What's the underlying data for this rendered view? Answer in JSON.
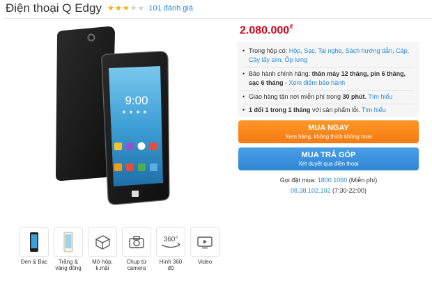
{
  "product": {
    "title": "Điện thoại Q Edgy",
    "rating_stars": 3,
    "rating_max": 5,
    "reviews_label": "101 đánh giá"
  },
  "phone_screen": {
    "time": "9:00"
  },
  "gallery": {
    "items": [
      {
        "label": "Đen & Bạc",
        "icon": "black-silver-phone-thumbnail"
      },
      {
        "label": "Trắng &\nvàng đồng",
        "icon": "white-gold-phone-thumbnail"
      },
      {
        "label": "Mở hộp,\nk.mãi",
        "icon": "open-box-icon"
      },
      {
        "label": "Chụp từ\ncamera",
        "icon": "camera-icon"
      },
      {
        "label": "Hình 360\nđộ",
        "icon": "rotate-360-icon"
      },
      {
        "label": "Video",
        "icon": "video-icon"
      }
    ],
    "label_360": "360°"
  },
  "purchase": {
    "price": "2.080.000",
    "currency": "₫",
    "in_box_prefix": "Trong hộp có: ",
    "in_box_items": "Hộp, Sạc, Tai nghe, Sách hướng dẫn, Cáp, Cây lấy sim, Ốp lưng",
    "warranty_prefix": "Bảo hành chính hãng: ",
    "warranty_bold": "thân máy 12 tháng, pin 6 tháng, sạc 6 tháng",
    "warranty_link": "Xem điểm bảo hành",
    "delivery_prefix": "Giao hàng tận nơi miễn phí trong ",
    "delivery_bold": "30 phút",
    "delivery_link": "Tìm hiểu",
    "exchange_bold": "1 đổi 1 trong 1 tháng",
    "exchange_text": " với sản phẩm lỗi.",
    "exchange_link": "Tìm hiểu",
    "buy_now": {
      "label": "MUA NGAY",
      "sub": "Xem hàng, không thích không mua"
    },
    "installment": {
      "label": "MUA TRẢ GÓP",
      "sub": "Xét duyệt qua điện thoại"
    },
    "hotline_label": "Gọi đặt mua: ",
    "hotline_number": "1800.1060",
    "hotline_note": " (Miễn phí)",
    "hotline2_number": "08.38.102.102",
    "hotline2_hours": " (7:30-22:00)"
  },
  "colors": {
    "price_red": "#d0021b",
    "buy_orange": "#f57b11",
    "installment_blue": "#2f86d3",
    "link_blue": "#288ad6",
    "star_yellow": "#fea700"
  }
}
